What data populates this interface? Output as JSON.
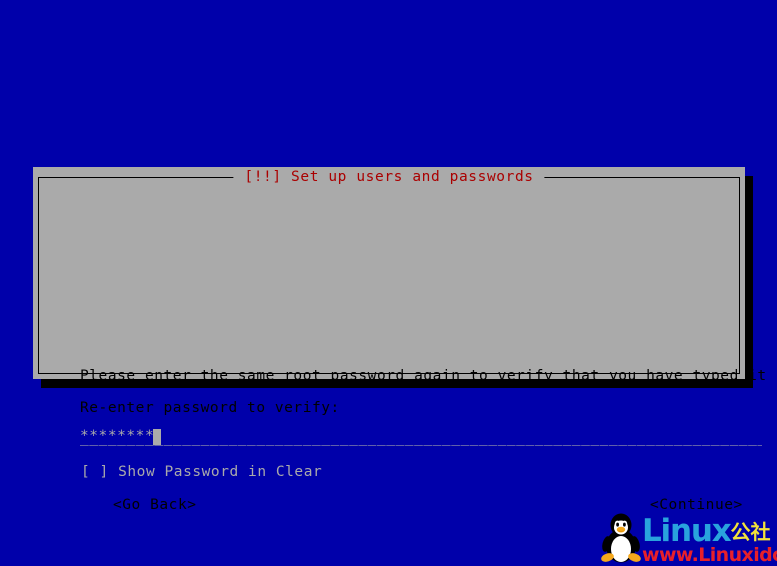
{
  "screen": {
    "background_color": "#0000aa",
    "dialog_background_color": "#aaaaaa",
    "title_color": "#aa0000",
    "highlight_color": "#0000aa",
    "highlight_text_color": "#aaaaaa"
  },
  "dialog": {
    "title": "[!!] Set up users and passwords",
    "prompt": "Please enter the same root password again to verify that you have typed it correctly.",
    "field_label": "Re-enter password to verify:",
    "password": {
      "masked_value": "********",
      "mask_character": "*",
      "character_count": 8,
      "rule": "____________________________________________________________________________"
    },
    "checkbox": {
      "label": "[ ] Show Password in Clear",
      "checked": false,
      "text": "Show Password in Clear"
    },
    "buttons": {
      "back": "<Go Back>",
      "continue": "<Continue>"
    }
  },
  "watermark": {
    "wordmark": "Linux",
    "wordmark_cn": "公社",
    "url": "www.Linuxidc.com",
    "logo_name": "tux-penguin-logo",
    "wordmark_color": "#29a3dd",
    "cn_color": "#f2e23a",
    "url_color": "#e8202a"
  }
}
